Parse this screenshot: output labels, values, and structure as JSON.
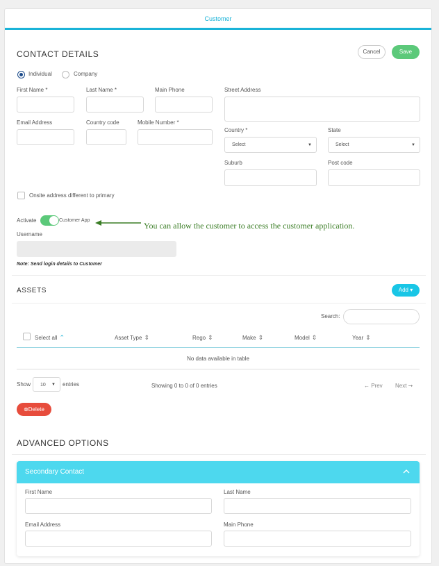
{
  "header": {
    "tab_title": "Customer"
  },
  "contact": {
    "title": "CONTACT DETAILS",
    "cancel_label": "Cancel",
    "save_label": "Save",
    "type_options": [
      "Individual",
      "Company"
    ],
    "selected_type": "Individual",
    "first_name_label": "First Name *",
    "last_name_label": "Last Name *",
    "main_phone_label": "Main Phone",
    "street_label": "Street Address",
    "email_label": "Email Address",
    "country_code_label": "Country code",
    "mobile_label": "Mobile Number *",
    "country_label": "Country *",
    "country_value": "Select",
    "state_label": "State",
    "state_value": "Select",
    "suburb_label": "Suburb",
    "postcode_label": "Post code",
    "onsite_label": "Onsite address different to primary",
    "activate_label": "Activate",
    "customer_app_label": "Customer App",
    "customer_app_on": true,
    "username_label": "Username",
    "note": "Note: Send login details to Customer"
  },
  "annotation": {
    "text": "You can allow the customer to access the customer application."
  },
  "assets": {
    "title": "ASSETS",
    "add_label": "Add ▾",
    "search_label": "Search:",
    "columns": [
      "Select all",
      "Asset Type",
      "Rego",
      "Make",
      "Model",
      "Year"
    ],
    "empty_text": "No data available in table",
    "show_label": "Show",
    "page_size": "10",
    "entries_label": "entries",
    "info": "Showing 0 to 0 of 0 entries",
    "prev_label": "← Prev",
    "next_label": "Next ➞",
    "delete_label": "Delete"
  },
  "advanced": {
    "title": "ADVANCED OPTIONS",
    "secondary_contact": {
      "title": "Secondary Contact",
      "first_name_label": "First Name",
      "last_name_label": "Last Name",
      "email_label": "Email Address",
      "main_phone_label": "Main Phone"
    }
  },
  "colors": {
    "accent": "#1ab3d8",
    "save_green": "#5cc97a",
    "add_cyan": "#19c6e6",
    "delete_red": "#e74c3c",
    "card_header": "#4dd8ee",
    "annotation_green": "#3a7d25"
  }
}
